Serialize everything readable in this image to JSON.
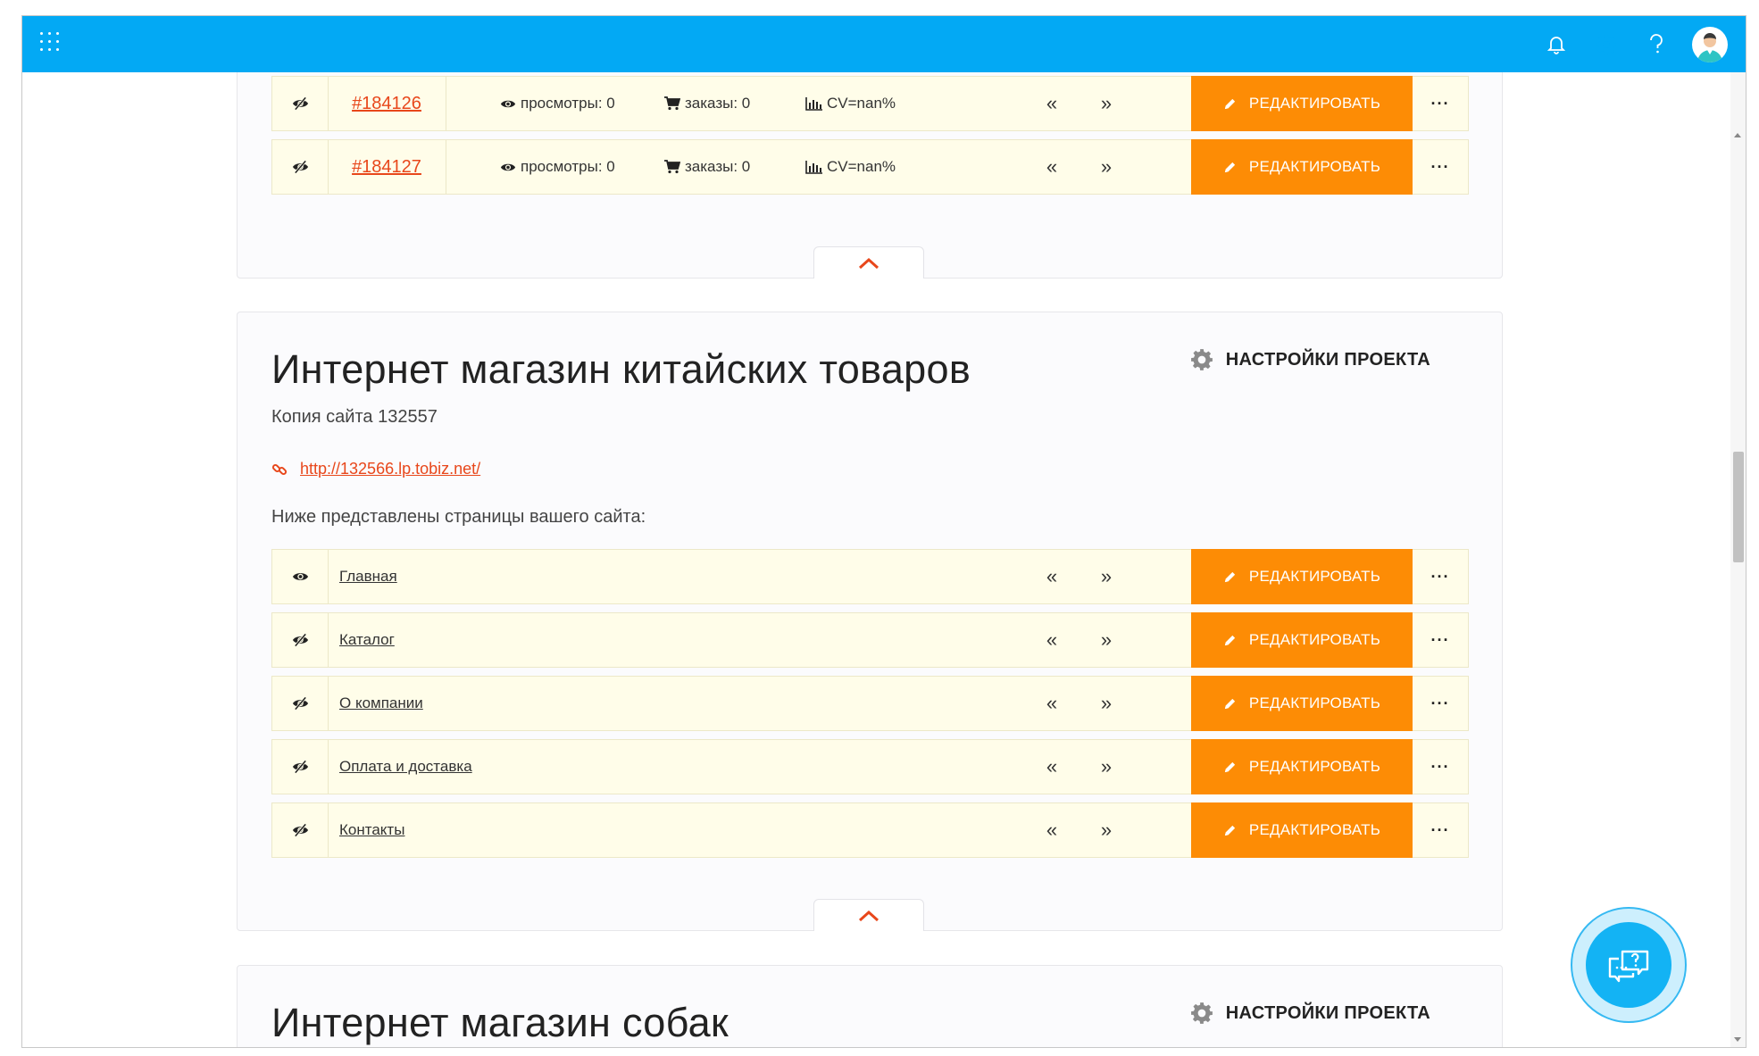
{
  "colors": {
    "topbar": "#03a9f4",
    "accent": "#fd8c05",
    "link": "#e8471b",
    "row_bg": "#fffde9"
  },
  "topbar": {
    "icons": [
      "apps-grid-icon",
      "bell-icon",
      "gear-icon",
      "help-icon",
      "avatar"
    ]
  },
  "top_rows": [
    {
      "id": "#184126",
      "views": "просмотры: 0",
      "orders": "заказы: 0",
      "cv": "CV=nan%",
      "prev": "«",
      "next": "»",
      "edit": "РЕДАКТИРОВАТЬ",
      "more": "···"
    },
    {
      "id": "#184127",
      "views": "просмотры: 0",
      "orders": "заказы: 0",
      "cv": "CV=nan%",
      "prev": "«",
      "next": "»",
      "edit": "РЕДАКТИРОВАТЬ",
      "more": "···"
    }
  ],
  "project1": {
    "title": "Интернет магазин китайских товаров",
    "settings_label": "НАСТРОЙКИ ПРОЕКТА",
    "subtitle": "Копия сайта 132557",
    "url": "http://132566.lp.tobiz.net/",
    "pages_intro": "Ниже представлены страницы вашего сайта:",
    "pages": [
      {
        "name": "Главная",
        "prev": "«",
        "next": "»",
        "edit": "РЕДАКТИРОВАТЬ",
        "more": "···",
        "visible": true
      },
      {
        "name": "Каталог",
        "prev": "«",
        "next": "»",
        "edit": "РЕДАКТИРОВАТЬ",
        "more": "···",
        "visible": false
      },
      {
        "name": "О компании",
        "prev": "«",
        "next": "»",
        "edit": "РЕДАКТИРОВАТЬ",
        "more": "···",
        "visible": false
      },
      {
        "name": "Оплата и доставка",
        "prev": "«",
        "next": "»",
        "edit": "РЕДАКТИРОВАТЬ",
        "more": "···",
        "visible": false
      },
      {
        "name": "Контакты",
        "prev": "«",
        "next": "»",
        "edit": "РЕДАКТИРОВАТЬ",
        "more": "···",
        "visible": false
      }
    ]
  },
  "project2": {
    "title": "Интернет магазин собак",
    "settings_label": "НАСТРОЙКИ ПРОЕКТА"
  }
}
